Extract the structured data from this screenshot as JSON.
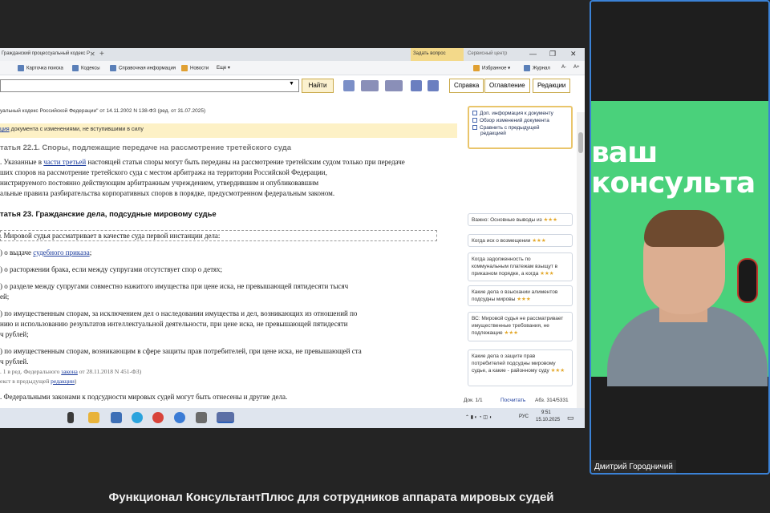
{
  "tabs": {
    "doc_tab": "Гражданский процессуальный кодекс Российской Федерации",
    "close": "✕",
    "plus": "+",
    "ask": "Задать вопрос",
    "service": "Сервисный центр",
    "win_min": "—",
    "win_max": "❐",
    "win_close": "✕"
  },
  "toolbar": {
    "card_search": "Карточка поиска",
    "codes": "Кодексы",
    "reference": "Справочная информация",
    "news": "Новости",
    "more": "Еще ▾",
    "favorites": "Избранное ▾",
    "journal": "Журнал",
    "font_down": "A-",
    "font_up": "A+"
  },
  "search": {
    "find_label": "Найти",
    "dropdown": "▼",
    "help": "Справка",
    "contents": "Оглавление",
    "editions": "Редакции"
  },
  "document": {
    "header": "уальный кодекс Российской Федерации\" от 14.11.2002 N 138-ФЗ (ред. от 31.07.2025)",
    "edition_note_link": "ция",
    "edition_note": " документа с изменениями, не вступившими в силу",
    "art22_title": "татья 22.1. Споры, подлежащие передаче на рассмотрение третейского суда",
    "art22_l1a": ". Указанные в ",
    "art22_l1_link": "части третьей",
    "art22_l1b": " настоящей статьи споры могут быть переданы на рассмотрение третейским судом только при передаче",
    "art22_l2": "ших споров на рассмотрение третейского суда с местом арбитража на территории Российской Федерации,",
    "art22_l3": "нистрируемого постоянно действующим арбитражным учреждением, утвердившим и опубликовавшим",
    "art22_l4": "альные правила разбирательства корпоративных споров в порядке, предусмотренном федеральным законом.",
    "art23_title": "татья 23. Гражданские дела, подсудные мировому судье",
    "p1": ". Мировой судья рассматривает в качестве суда первой инстанции дела:",
    "p2a": ") о выдаче ",
    "p2_link": "судебного приказа",
    "p2b": ";",
    "p3": ") о расторжении брака, если между супругами отсутствует спор о детях;",
    "p4a": ") о разделе между супругами совместно нажитого имущества при цене иска, не превышающей пятидесяти тысяч",
    "p4b": "ей;",
    "p5a": ") по имущественным спорам, за исключением дел о наследовании имущества и дел, возникающих из отношений по",
    "p5b": "нию и использованию результатов интеллектуальной деятельности, при цене иска, не превышающей пятидесяти",
    "p5c": "ч рублей;",
    "p6a": ") по имущественным спорам, возникающим в сфере защиты прав потребителей, при цене иска, не превышающей ста",
    "p6b": "ч рублей.",
    "p6_note_a": ". 1 в ред. Федерального ",
    "p6_note_link": "закона",
    "p6_note_b": " от 28.11.2018 N 451-ФЗ)",
    "p6_note2a": "екст в предыдущей ",
    "p6_note2_link": "редакции",
    "p6_note2b": ")",
    "p7": ". Федеральными законами к подсудности мировых судей могут быть отнесены и другие дела."
  },
  "side_panel": {
    "l1": "Доп. информация к документу",
    "l2": "Обзор изменений документа",
    "l3": "Сравнить с предыдущей",
    "l3b": "редакцией"
  },
  "cards": [
    {
      "text": "Важно: Основные выводы из",
      "stars": "★★★"
    },
    {
      "text": "Когда иск о возмещении",
      "stars": "★★★"
    },
    {
      "text": "Когда задолженность по коммунальным платежам взыщут в приказном порядке, а когда",
      "stars": "★★★"
    },
    {
      "text": "Какие дела о взыскании алиментов подсудны мировы",
      "stars": "★★★"
    },
    {
      "text": "ВС: Мировой судья не рассматривает имущественные требования, не подлежащие",
      "stars": "★★★"
    },
    {
      "text": "Какие дела о защите прав потребителей подсудны мировому судье, а какие - районному суду",
      "stars": "★★★"
    }
  ],
  "status": {
    "doc": "Док. 1/1",
    "compute": "Посчитать",
    "para": "Абз. 314/5331"
  },
  "taskbar": {
    "lang": "РУС",
    "time": "9:51",
    "date": "15.10.2025"
  },
  "camera": {
    "brand_line1": "ваш",
    "brand_line2": "консульта",
    "name": "Дмитрий Городничий"
  },
  "caption": "Функционал КонсультантПлюс для сотрудников аппарата мировых судей"
}
